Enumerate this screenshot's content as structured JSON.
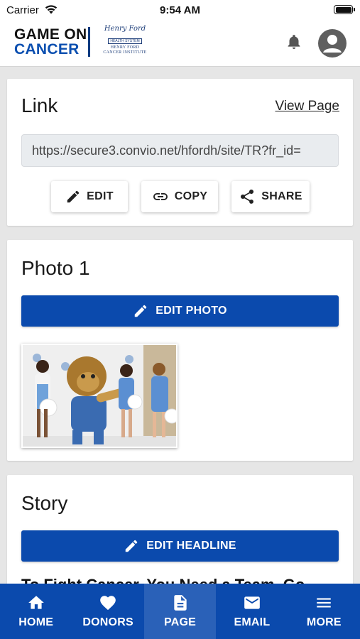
{
  "status_bar": {
    "carrier": "Carrier",
    "time": "9:54 AM"
  },
  "header": {
    "brand_line1": "GAME ON",
    "brand_line2": "CANCER",
    "partner_script": "Henry Ford",
    "partner_box": "HEALTH SYSTEM",
    "partner_sub1": "HENRY FORD",
    "partner_sub2": "CANCER INSTITUTE"
  },
  "link_card": {
    "title": "Link",
    "view_page_label": "View Page",
    "url": "https://secure3.convio.net/hfordh/site/TR?fr_id=",
    "edit_label": "EDIT",
    "copy_label": "COPY",
    "share_label": "SHARE"
  },
  "photo_card": {
    "title": "Photo 1",
    "edit_photo_label": "EDIT PHOTO"
  },
  "story_card": {
    "title": "Story",
    "edit_headline_label": "EDIT HEADLINE",
    "headline": "To Fight Cancer, You Need a Team. Go..."
  },
  "bottom_nav": {
    "items": [
      {
        "label": "HOME",
        "icon": "home-icon"
      },
      {
        "label": "DONORS",
        "icon": "heart-icon"
      },
      {
        "label": "PAGE",
        "icon": "page-icon"
      },
      {
        "label": "EMAIL",
        "icon": "email-icon"
      },
      {
        "label": "MORE",
        "icon": "menu-icon"
      }
    ],
    "active": "PAGE"
  },
  "colors": {
    "primary": "#0b4aad",
    "nav_active": "#2a61b8",
    "background": "#e6e6e6"
  }
}
